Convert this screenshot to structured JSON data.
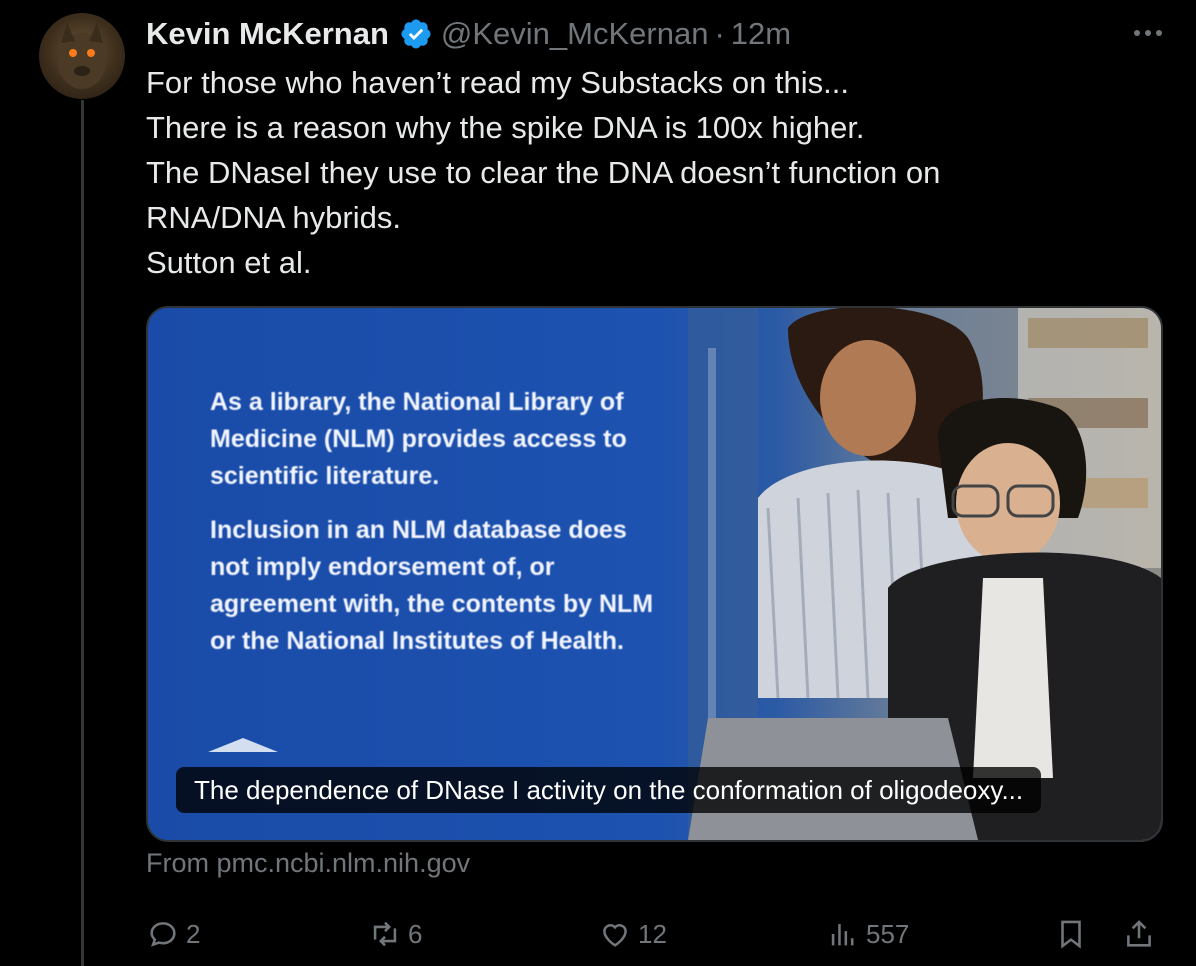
{
  "author": {
    "name": "Kevin McKernan",
    "handle": "@Kevin_McKernan",
    "separator": "·",
    "time": "12m",
    "verified": true
  },
  "tweet": {
    "lines": [
      "For those who haven’t read my Substacks on this...",
      "There is a reason why the spike DNA is 100x higher.",
      "The DNaseI they use to clear the DNA doesn’t function on",
      "RNA/DNA hybrids.",
      "Sutton et al."
    ]
  },
  "card": {
    "image_text": {
      "paragraph1": "As a library, the National Library of Medicine (NLM) provides access to scientific literature.",
      "paragraph2": "Inclusion in an NLM database does not imply endorsement of, or agreement with, the contents by NLM or the National Institutes of Health."
    },
    "title": "The dependence of DNase I activity on the conformation of oligodeoxy...",
    "source": "From pmc.ncbi.nlm.nih.gov"
  },
  "actions": {
    "replies": "2",
    "reposts": "6",
    "likes": "12",
    "views": "557"
  },
  "colors": {
    "background": "#000000",
    "text": "#e7e9ea",
    "muted": "#71767b",
    "verified": "#1d9bf0",
    "card_blue": "#1a4ba8"
  },
  "icons": [
    "more-icon",
    "verified-badge-icon",
    "reply-icon",
    "repost-icon",
    "like-icon",
    "views-icon",
    "bookmark-icon",
    "share-icon"
  ]
}
